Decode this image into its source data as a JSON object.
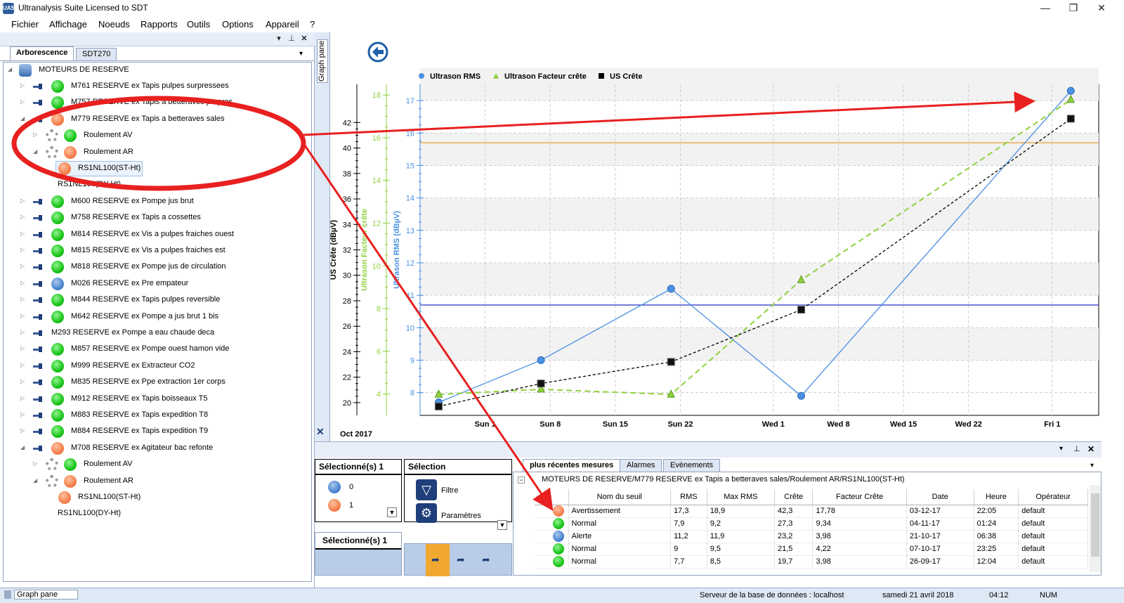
{
  "window": {
    "title": "Ultranalysis Suite Licensed to SDT",
    "app_icon": "UAS"
  },
  "menu": [
    "Fichier",
    "Affichage",
    "Noeuds",
    "Rapports",
    "Outils",
    "Options",
    "Appareil",
    "?"
  ],
  "left_tabs": [
    "Arborescence",
    "SDT270"
  ],
  "tree": {
    "root": "MOTEURS DE RESERVE",
    "items": [
      {
        "label": "M761 RESERVE ex Tapis pulpes surpressees",
        "status": "green"
      },
      {
        "label": "M757 RESERVE ex Tapis a betteraves propres",
        "status": "green"
      },
      {
        "label": "M779 RESERVE ex Tapis a betteraves sales",
        "status": "orange"
      },
      {
        "label": "Roulement AV",
        "status": "green"
      },
      {
        "label": "Roulement AR",
        "status": "orange"
      },
      {
        "label": "RS1NL100(ST-Ht)",
        "status": "orange"
      },
      {
        "label": "RS1NL100(DY-Ht)"
      },
      {
        "label": "M600 RESERVE ex  Pompe jus brut",
        "status": "green"
      },
      {
        "label": "M758 RESERVE ex Tapis a cossettes",
        "status": "green"
      },
      {
        "label": "M814 RESERVE ex Vis a pulpes fraiches ouest",
        "status": "green"
      },
      {
        "label": "M815 RESERVE ex Vis a pulpes fraiches est",
        "status": "green"
      },
      {
        "label": "M818 RESERVE ex  Pompe jus de circulation",
        "status": "green"
      },
      {
        "label": "M026 RESERVE ex Pre empateur",
        "status": "blue"
      },
      {
        "label": "M844 RESERVE ex Tapis pulpes reversible",
        "status": "green"
      },
      {
        "label": "M642 RESERVE ex Pompe a jus brut 1 bis",
        "status": "green"
      },
      {
        "label": "M293 RESERVE ex Pompe a eau chaude deca"
      },
      {
        "label": "M857 RESERVE ex Pompe ouest hamon vide",
        "status": "green"
      },
      {
        "label": "M999 RESERVE ex Extracteur CO2",
        "status": "green"
      },
      {
        "label": "M835 RESERVE ex Ppe extraction 1er corps",
        "status": "green"
      },
      {
        "label": "M912 RESERVE ex Tapis boisseaux T5",
        "status": "green"
      },
      {
        "label": "M883 RESERVE ex Tapis expedition T8",
        "status": "green"
      },
      {
        "label": "M884 RESERVE ex Tapis expedition T9",
        "status": "green"
      },
      {
        "label": "M708 RESERVE ex Agitateur bac refonte",
        "status": "orange"
      },
      {
        "label": "Roulement AV",
        "status": "green"
      },
      {
        "label": "Roulement AR",
        "status": "orange"
      },
      {
        "label": "RS1NL100(ST-Ht)",
        "status": "orange"
      },
      {
        "label": "RS1NL100(DY-Ht)"
      }
    ]
  },
  "graph_pane": {
    "side_tab": "Graph pane"
  },
  "chart_data": {
    "type": "line",
    "legend": [
      "Ultrason RMS",
      "Ultrason Facteur crête",
      "US Crête"
    ],
    "legend_position": "top-left",
    "x_ticks": [
      "Sun 1",
      "Sun 8",
      "Sun 15",
      "Sun 22",
      "Wed 1",
      "Wed 8",
      "Wed 15",
      "Wed 22",
      "Fri 1"
    ],
    "x_start_label": "Oct 2017",
    "axes": {
      "us_crete": {
        "label": "US Crête (dBµV)",
        "ticks": [
          20,
          22,
          24,
          26,
          28,
          30,
          32,
          34,
          36,
          38,
          40,
          42
        ],
        "range": [
          19,
          45
        ]
      },
      "facteur_crete": {
        "label": "Ultrason Facteur crête",
        "ticks": [
          4,
          6,
          8,
          10,
          12,
          14,
          16,
          18
        ],
        "range": [
          3,
          18.5
        ]
      },
      "rms": {
        "label": "Ultrason RMS (dBµV)",
        "ticks": [
          8,
          9,
          10,
          11,
          12,
          13,
          14,
          15,
          16,
          17
        ],
        "range": [
          7.3,
          17.5
        ]
      }
    },
    "x_dates": [
      "26-09-17",
      "07-10-17",
      "21-10-17",
      "04-11-17",
      "03-12-17"
    ],
    "series": [
      {
        "name": "Ultrason RMS",
        "color": "#4a90e2",
        "values": [
          7.7,
          9,
          11.2,
          7.9,
          17.3
        ]
      },
      {
        "name": "Ultrason Facteur crête",
        "color": "#8fd13f",
        "values": [
          3.98,
          4.22,
          3.98,
          9.34,
          17.78
        ]
      },
      {
        "name": "US Crête",
        "color": "#000000",
        "values": [
          19.7,
          21.5,
          23.2,
          27.3,
          42.3
        ]
      }
    ],
    "threshold_lines": [
      {
        "color": "#e6a030",
        "rms": 15.7
      },
      {
        "color": "#2030c0",
        "rms": 10.7
      }
    ],
    "grid": true
  },
  "bottom": {
    "sel_header_left": "Sélectionné(s) 1",
    "sel_header_right": "Sélection",
    "sel_values": [
      "0",
      "1"
    ],
    "filter_label": "Filtre",
    "params_label": "Paramètres",
    "sel_bottom": "Sélectionné(s) 1",
    "tabs": [
      "plus récentes mesures",
      "Alarmes",
      "Evènements"
    ],
    "path": "MOTEURS DE RESERVE/M779 RESERVE ex Tapis a betteraves sales/Roulement AR/RS1NL100(ST-Ht)",
    "columns": [
      "Nom du seuil",
      "RMS",
      "Max RMS",
      "Crête",
      "Facteur Crête",
      "Date",
      "Heure",
      "Opérateur"
    ],
    "rows": [
      {
        "status": "orange",
        "cells": [
          "Avertissement",
          "17,3",
          "18,9",
          "42,3",
          "17,78",
          "03-12-17",
          "22:05",
          "default"
        ]
      },
      {
        "status": "green",
        "cells": [
          "Normal",
          "7,9",
          "9,2",
          "27,3",
          "9,34",
          "04-11-17",
          "01:24",
          "default"
        ]
      },
      {
        "status": "blue",
        "cells": [
          "Alerte",
          "11,2",
          "11,9",
          "23,2",
          "3,98",
          "21-10-17",
          "06:38",
          "default"
        ]
      },
      {
        "status": "green",
        "cells": [
          "Normal",
          "9",
          "9,5",
          "21,5",
          "4,22",
          "07-10-17",
          "23:25",
          "default"
        ]
      },
      {
        "status": "green",
        "cells": [
          "Normal",
          "7,7",
          "8,5",
          "19,7",
          "3,98",
          "26-09-17",
          "12:04",
          "default"
        ]
      }
    ]
  },
  "status": {
    "left": "Graph pane",
    "server": "Serveur de la base de données : localhost",
    "date": "samedi 21 avril 2018",
    "time": "04:12",
    "num": "NUM"
  }
}
